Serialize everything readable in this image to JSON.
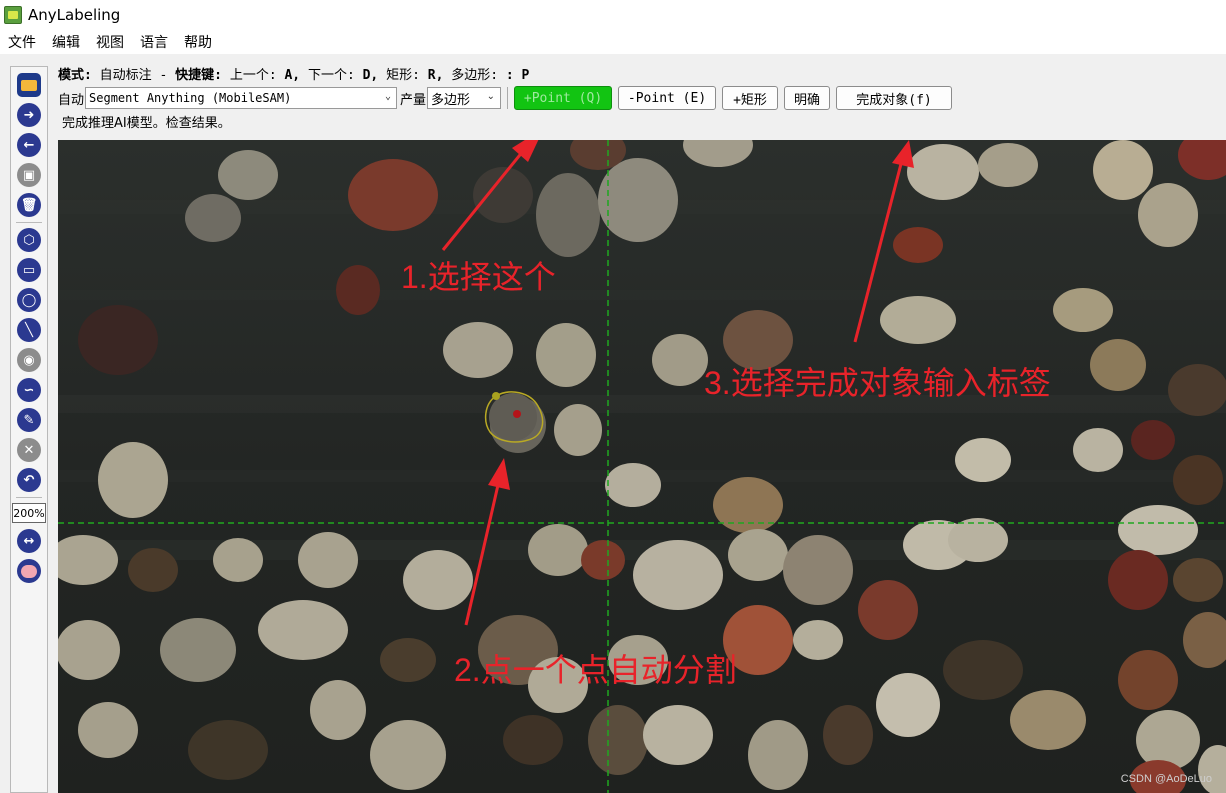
{
  "window": {
    "title": "AnyLabeling"
  },
  "menu": [
    "文件",
    "编辑",
    "视图",
    "语言",
    "帮助"
  ],
  "panel": {
    "mode_label": "模式:",
    "mode_value": "自动标注",
    "dash": "-",
    "shortcut_label": "快捷键:",
    "prev_label": "上一个:",
    "prev_key": "A,",
    "next_label": "下一个:",
    "next_key": "D,",
    "rect_label": "矩形:",
    "rect_key": "R,",
    "poly_label": "多边形:",
    "poly_key": ": P",
    "auto_label": "自动",
    "model_select": "Segment Anything (MobileSAM)",
    "output_label": "产量",
    "output_select": "多边形",
    "buttons": {
      "add_point": "+Point (Q)",
      "remove_point": "-Point (E)",
      "add_rect": "+矩形",
      "clear": "明确",
      "finish": "完成对象(f)"
    },
    "status": "完成推理AI模型。检查结果。"
  },
  "toolbar": {
    "zoom": "200%"
  },
  "annotations": {
    "step1": "1.选择这个",
    "step2": "2.点一个点自动分割",
    "step3": "3.选择完成对象输入标签"
  },
  "watermark": "CSDN @AoDeLuo",
  "colors": {
    "annotation_red": "#e8232a",
    "active_button_green": "#12c412",
    "crosshair_green": "#1fa81f",
    "polygon_yellow": "#b9a924",
    "point_red": "#b5141a"
  }
}
